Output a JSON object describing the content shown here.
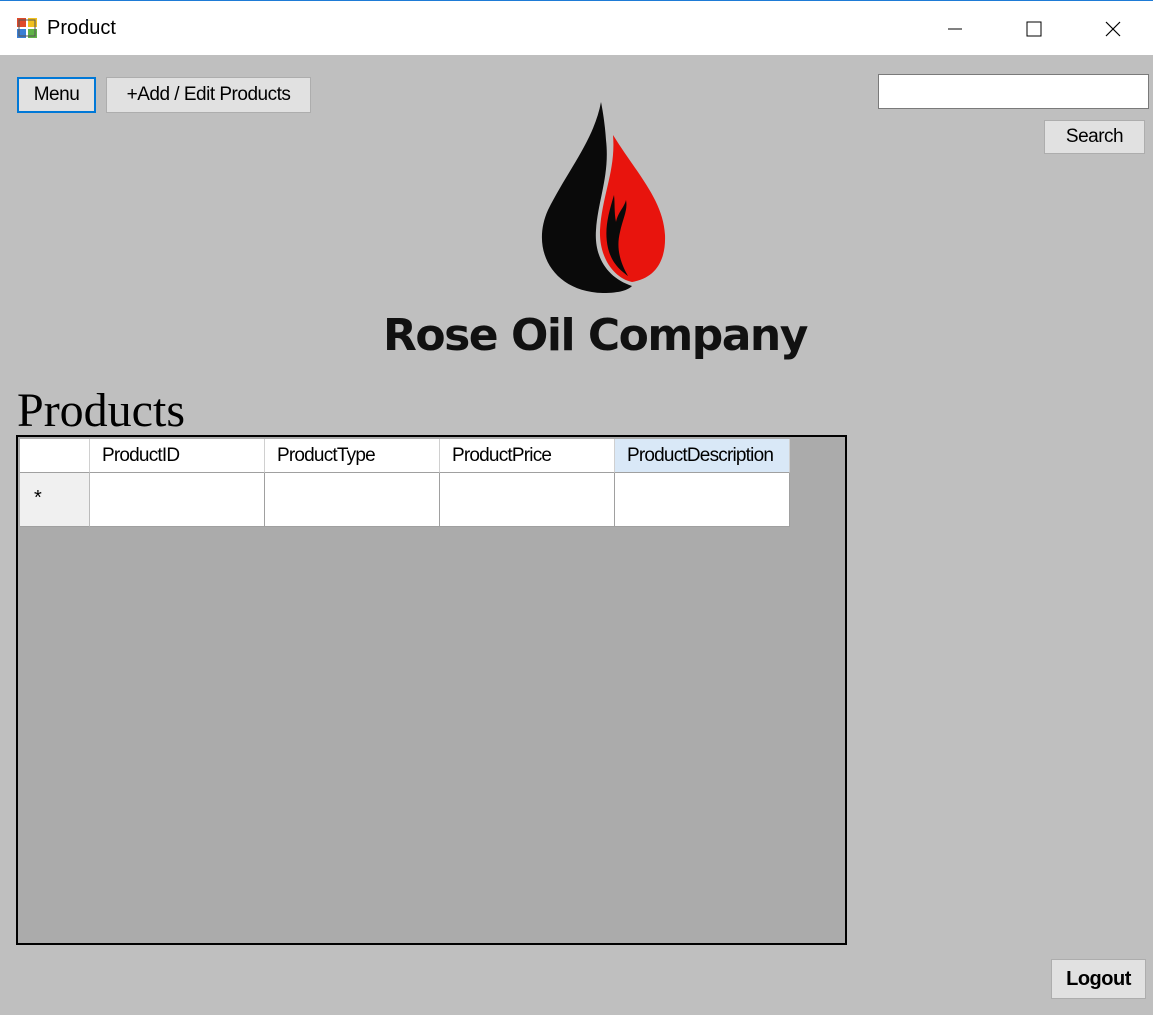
{
  "window": {
    "title": "Product",
    "minimize_icon": "minimize-icon",
    "maximize_icon": "maximize-icon",
    "close_icon": "close-icon"
  },
  "toolbar": {
    "menu_label": "Menu",
    "add_edit_label": "+Add / Edit Products"
  },
  "search": {
    "value": "",
    "button_label": "Search"
  },
  "brand": {
    "name": "Rose Oil Company",
    "logo_icon": "oil-flame-logo",
    "colors": {
      "drop": "#0a0a0a",
      "flame": "#e8140d"
    }
  },
  "products": {
    "title": "Products",
    "columns": [
      "ProductID",
      "ProductType",
      "ProductPrice",
      "ProductDescription"
    ],
    "selected_column": "ProductDescription",
    "new_row_marker": "*",
    "rows": []
  },
  "footer": {
    "logout_label": "Logout"
  }
}
